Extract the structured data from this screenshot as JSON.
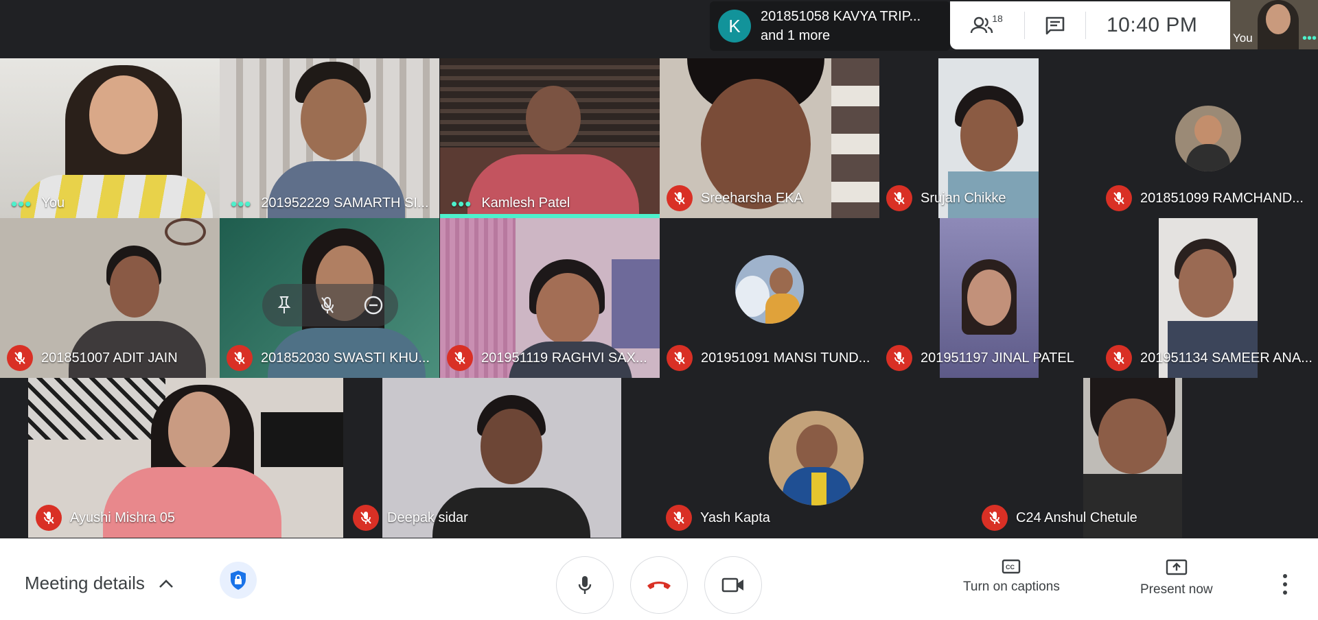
{
  "joiner": {
    "initial": "K",
    "line1": "201851058 KAVYA TRIP...",
    "line2": "and 1 more"
  },
  "info": {
    "people_count": "18",
    "time": "10:40  PM"
  },
  "selfview": {
    "label": "You"
  },
  "tiles": [
    {
      "name": "You",
      "muted": false,
      "speaking": false
    },
    {
      "name": "201952229 SAMARTH SI...",
      "muted": false,
      "speaking": false
    },
    {
      "name": "Kamlesh Patel",
      "muted": false,
      "speaking": true
    },
    {
      "name": "Sreeharsha EKA",
      "muted": true
    },
    {
      "name": "Srujan Chikke",
      "muted": true
    },
    {
      "name": "201851099 RAMCHAND...",
      "muted": true
    },
    {
      "name": "201851007 ADIT JAIN",
      "muted": true
    },
    {
      "name": "201852030 SWASTI KHU...",
      "muted": true
    },
    {
      "name": "201951119 RAGHVI SAX...",
      "muted": true
    },
    {
      "name": "201951091 MANSI TUND...",
      "muted": true
    },
    {
      "name": "201951197 JINAL PATEL",
      "muted": true
    },
    {
      "name": "201951134 SAMEER ANA...",
      "muted": true
    },
    {
      "name": "Ayushi Mishra 05",
      "muted": true
    },
    {
      "name": "Deepak sidar",
      "muted": true
    },
    {
      "name": "Yash Kapta",
      "muted": true
    },
    {
      "name": "C24 Anshul Chetule",
      "muted": true
    }
  ],
  "bottom": {
    "meeting_details": "Meeting details",
    "captions": "Turn on captions",
    "present": "Present now"
  },
  "colors": {
    "accent": "#4df1cc",
    "mic_off": "#d93025",
    "end_call": "#d93025",
    "bar": "#202124"
  }
}
